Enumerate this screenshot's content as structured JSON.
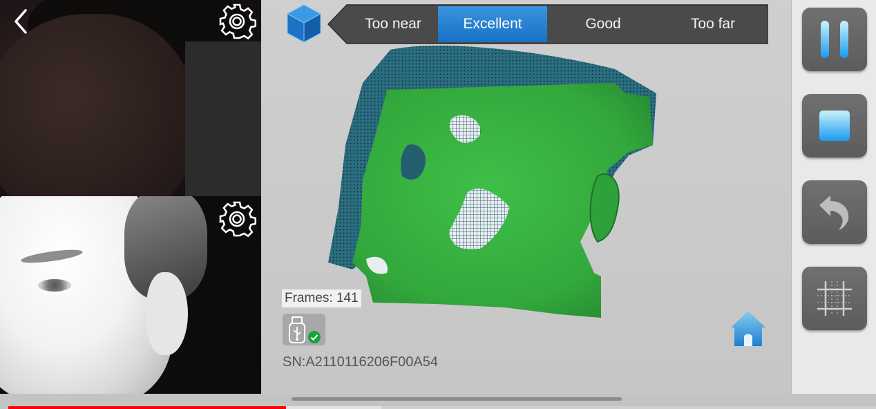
{
  "app": {
    "colors": {
      "accent_blue": "#1f7fd0",
      "mesh_green": "#35b03f",
      "point_cloud_teal": "#1f5d6e",
      "progress_red": "#ff0000"
    }
  },
  "camera_panels": {
    "back_icon": "chevron-left-icon",
    "top_settings_icon": "gear-icon",
    "bottom_settings_icon": "gear-icon"
  },
  "distance_indicator": {
    "icon": "cube-icon",
    "options": [
      {
        "label": "Too near",
        "active": false
      },
      {
        "label": "Excellent",
        "active": true
      },
      {
        "label": "Good",
        "active": false
      },
      {
        "label": "Too far",
        "active": false
      }
    ]
  },
  "status": {
    "frames_label": "Frames: 141",
    "usb_icon": "usb-drive-icon",
    "usb_status_icon": "check-circle-icon",
    "serial": "SN:A2110116206F00A54"
  },
  "controls": {
    "pause_icon": "pause-icon",
    "stop_icon": "stop-icon",
    "undo_icon": "undo-icon",
    "grid_icon": "grid-icon",
    "home_icon": "home-icon"
  },
  "video_player": {
    "progress_fraction": 0.32,
    "buffered_fraction": 0.43
  }
}
